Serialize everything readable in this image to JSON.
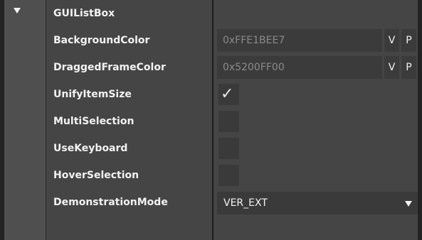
{
  "section": {
    "title": "GUIListBox",
    "expand_icon": "triangle-down-icon"
  },
  "properties": {
    "background_color": {
      "label": "BackgroundColor",
      "value": "0xFFE1BEE7",
      "v_label": "V",
      "p_label": "P"
    },
    "dragged_frame_color": {
      "label": "DraggedFrameColor",
      "value": "0x5200FF00",
      "v_label": "V",
      "p_label": "P"
    },
    "unify_item_size": {
      "label": "UnifyItemSize",
      "checked": true,
      "check_glyph": "✓"
    },
    "multi_selection": {
      "label": "MultiSelection",
      "checked": false
    },
    "use_keyboard": {
      "label": "UseKeyboard",
      "checked": false
    },
    "hover_selection": {
      "label": "HoverSelection",
      "checked": false
    },
    "demonstration_mode": {
      "label": "DemonstrationMode",
      "selected": "VER_EXT",
      "dropdown_icon": "triangle-down-icon"
    }
  },
  "colors": {
    "panel_bg": "#454545",
    "field_bg": "#3b3b3b",
    "label_text": "#f2f2f2",
    "muted_text": "#8a8a8a"
  }
}
